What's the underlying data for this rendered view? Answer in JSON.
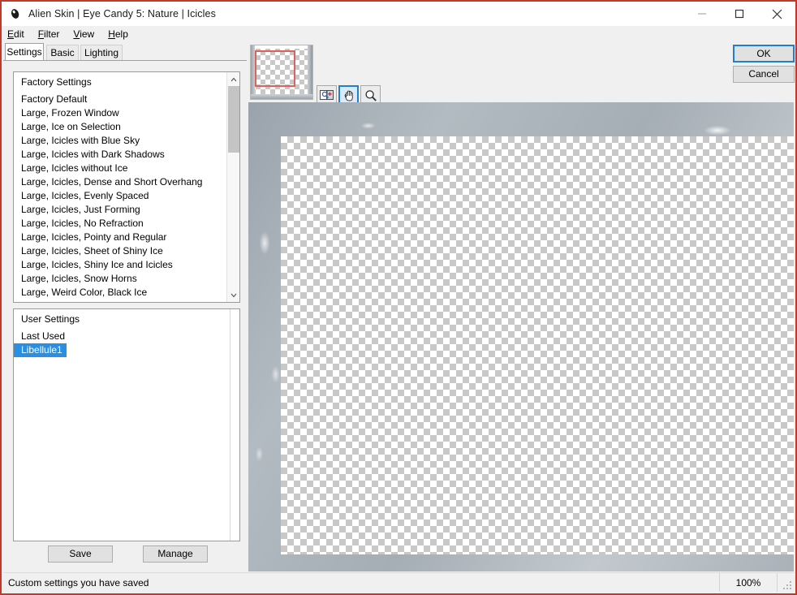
{
  "window": {
    "title": "Alien Skin | Eye Candy 5: Nature | Icicles",
    "app_icon": "alien-eye-icon",
    "border_color": "#c0392b",
    "controls": {
      "minimize": "minimize-icon",
      "maximize": "maximize-icon",
      "close": "close-icon"
    }
  },
  "menubar": {
    "items": [
      {
        "label": "Edit",
        "accel": "E"
      },
      {
        "label": "Filter",
        "accel": "F"
      },
      {
        "label": "View",
        "accel": "V"
      },
      {
        "label": "Help",
        "accel": "H"
      }
    ]
  },
  "tabs": [
    {
      "label": "Settings",
      "active": true
    },
    {
      "label": "Basic",
      "active": false
    },
    {
      "label": "Lighting",
      "active": false
    }
  ],
  "factory_list": {
    "header": "Factory Settings",
    "items": [
      "Factory Default",
      "Large, Frozen Window",
      "Large, Ice on Selection",
      "Large, Icicles with Blue Sky",
      "Large, Icicles with Dark Shadows",
      "Large, Icicles without Ice",
      "Large, Icicles, Dense and Short Overhang",
      "Large, Icicles, Evenly Spaced",
      "Large, Icicles, Just Forming",
      "Large, Icicles, No Refraction",
      "Large, Icicles, Pointy and Regular",
      "Large, Icicles, Sheet of Shiny Ice",
      "Large, Icicles, Shiny Ice and Icicles",
      "Large, Icicles, Snow Horns",
      "Large, Weird Color, Black Ice"
    ],
    "scrollbar": {
      "up_arrow": "chevron-up-icon",
      "down_arrow": "chevron-down-icon"
    }
  },
  "user_list": {
    "header": "User Settings",
    "items": [
      {
        "label": "Last Used",
        "selected": false
      },
      {
        "label": "Libellule1",
        "selected": true
      }
    ],
    "selection_color": "#2a8fe0"
  },
  "buttons": {
    "save": "Save",
    "manage": "Manage",
    "ok": "OK",
    "cancel": "Cancel"
  },
  "toolbar": {
    "tools": [
      {
        "name": "preview-compare-icon",
        "active": false
      },
      {
        "name": "hand-pan-icon",
        "active": true
      },
      {
        "name": "zoom-magnifier-icon",
        "active": false
      }
    ]
  },
  "navigator": {
    "name": "navigator-thumbnail",
    "viewport_color": "#e0605e"
  },
  "statusbar": {
    "message": "Custom settings you have saved",
    "zoom": "100%",
    "grip": "resize-grip-icon"
  }
}
